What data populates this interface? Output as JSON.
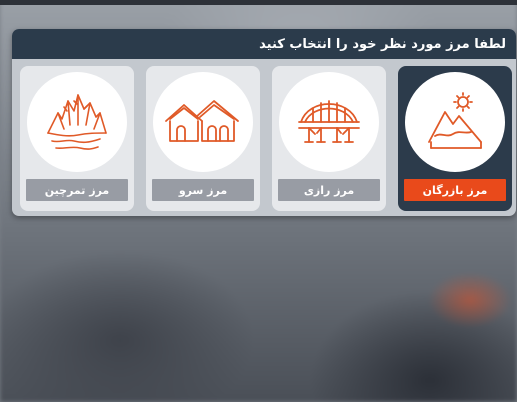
{
  "header": {
    "title": "لطفا مرز مورد نظر خود را انتخاب کنید"
  },
  "options": [
    {
      "label": "مرز بازرگان",
      "icon": "desert-sun-icon",
      "selected": true
    },
    {
      "label": "مرز رازی",
      "icon": "arch-bridge-icon",
      "selected": false
    },
    {
      "label": "مرز سرو",
      "icon": "houses-icon",
      "selected": false
    },
    {
      "label": "مرز تمرچین",
      "icon": "mountains-icon",
      "selected": false
    }
  ],
  "colors": {
    "accent": "#e94a1b",
    "header_bg": "#2b3b4b",
    "icon_stroke": "#e05a28",
    "label_inactive": "#989ca4"
  }
}
